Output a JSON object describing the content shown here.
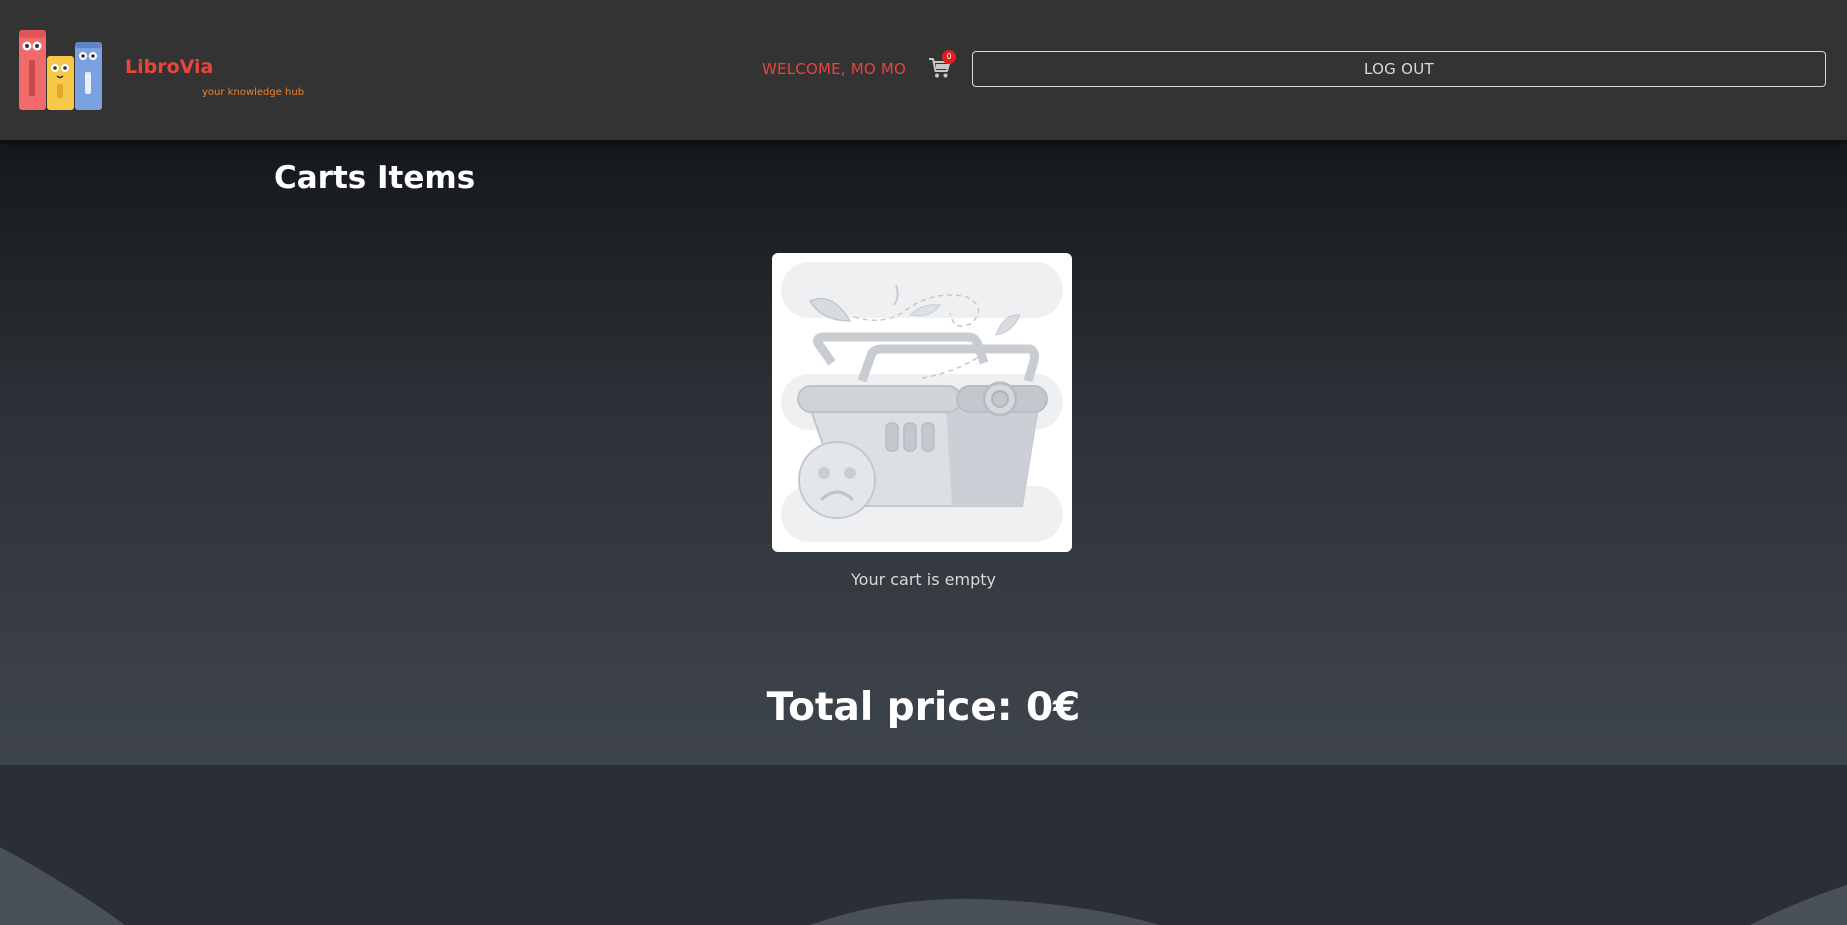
{
  "header": {
    "brand_name": "LibroVia",
    "tagline": "your knowledge hub",
    "welcome": "WELCOME, MO MO",
    "cart_count": "0",
    "logout_label": "LOG OUT"
  },
  "main": {
    "title": "Carts Items",
    "empty_message": "Your cart is empty",
    "total_label": "Total price: 0€"
  },
  "icons": {
    "logo": "books-logo-icon",
    "cart": "shopping-cart-icon",
    "empty_cart": "empty-basket-illustration"
  },
  "colors": {
    "brand_red": "#e8453c",
    "tagline_orange": "#f0812d",
    "header_bg": "#333333",
    "badge_red": "#e02020"
  }
}
